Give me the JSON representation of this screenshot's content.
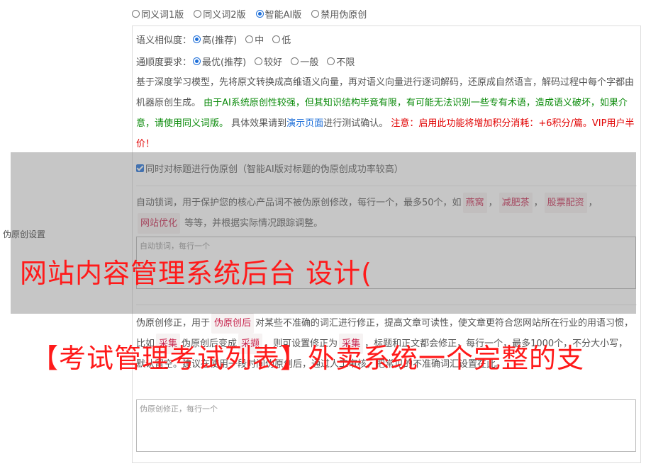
{
  "version_options": [
    {
      "label": "同义词1版",
      "checked": false
    },
    {
      "label": "同义词2版",
      "checked": false
    },
    {
      "label": "智能AI版",
      "checked": true
    },
    {
      "label": "禁用伪原创",
      "checked": false
    }
  ],
  "similarity": {
    "label": "语义相似度：",
    "options": [
      {
        "label": "高(推荐)",
        "checked": true
      },
      {
        "label": "中",
        "checked": false
      },
      {
        "label": "低",
        "checked": false
      }
    ]
  },
  "fluency": {
    "label": "通顺度要求：",
    "options": [
      {
        "label": "最优(推荐)",
        "checked": true
      },
      {
        "label": "较好",
        "checked": false
      },
      {
        "label": "一般",
        "checked": false
      },
      {
        "label": "不限",
        "checked": false
      }
    ]
  },
  "ai_desc": {
    "part1": "基于深度学习模型，先将原文转换成高维语义向量，再对语义向量进行逐词解码，还原成自然语言，解码过程中每个字都由机器原创生成。",
    "green": "由于AI系统原创性较强，但其知识结构毕竟有限，有可能无法识别一些专有术语，造成语义破坏，如果介意，请使用同义词版。",
    "part2": "具体效果请到",
    "link": "演示页面",
    "part3": "进行测试确认。",
    "red": "注意：启用此功能将增加积分消耗：+6积分/篇。VIP用户半价！"
  },
  "title_checkbox": {
    "label": "同时对标题进行伪原创（智能AI版对标题的伪原创成功率较高）",
    "checked": true
  },
  "lock_words": {
    "desc1": "自动锁词，用于保护您的核心产品词不被伪原创修改，每行一个，最多50个，如",
    "tags": [
      "燕窝",
      "减肥茶",
      "股票配资",
      "网站优化"
    ],
    "sep": "，",
    "desc2": "等等，并根据实际情况跟踪调整。",
    "placeholder": "自动锁词，每行一个"
  },
  "correction": {
    "desc1": "伪原创修正，用于",
    "tag1": "伪原创后",
    "desc2": "对某些不准确的词汇进行修正，提高文章可读性，使文章更符合您网站所在行业的用语习惯，比如",
    "tag2": "采集",
    "desc3": "伪原创后变成",
    "tag3": "采撷",
    "desc4": "，则可设置修正为",
    "tag4": "采集",
    "desc5": "，标题和正文都会修正，每行一个，最多1000个，不分大小写，默认留空。建议在使用一段时间伪原创后，通过人工审核，把常见的不准确词汇设置在此。",
    "placeholder": "伪原创修正，每行一个"
  },
  "side_label": "伪原创设置",
  "watermark": {
    "line1": "网站内容管理系统后台 设计(",
    "line2": "【考试管理考试列表】外卖系统一个完整的支"
  },
  "colors": {
    "accent": "#1e6fd9",
    "green": "#0a8a0a",
    "red": "#e10000",
    "watermark": "#ff1a1a"
  }
}
